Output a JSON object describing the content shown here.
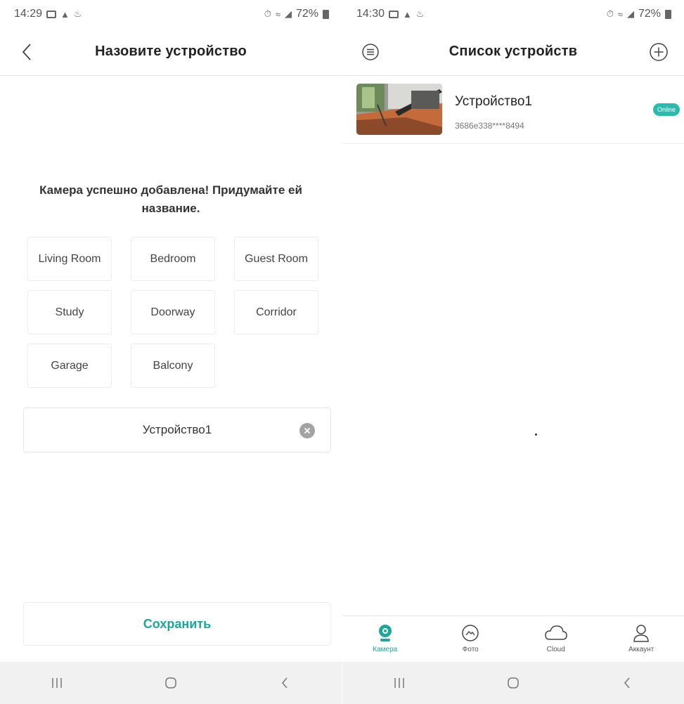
{
  "left": {
    "status": {
      "time": "14:29",
      "battery": "72%"
    },
    "header": {
      "title": "Назовите устройство"
    },
    "prompt": "Камера успешно добавлена! Придумайте ей название.",
    "chips": [
      "Living Room",
      "Bedroom",
      "Guest Room",
      "Study",
      "Doorway",
      "Corridor",
      "Garage",
      "Balcony"
    ],
    "name_input": {
      "value": "Устройство1"
    },
    "save_label": "Сохранить"
  },
  "right": {
    "status": {
      "time": "14:30",
      "battery": "72%"
    },
    "header": {
      "title": "Список устройств"
    },
    "device": {
      "name": "Устройство1",
      "id": "3686e338****8494",
      "status": "Online"
    },
    "tabs": [
      {
        "label": "Камера",
        "icon": "camera-icon",
        "active": true
      },
      {
        "label": "Фото",
        "icon": "photo-icon",
        "active": false
      },
      {
        "label": "Cloud",
        "icon": "cloud-icon",
        "active": false
      },
      {
        "label": "Аккаунт",
        "icon": "account-icon",
        "active": false
      }
    ]
  },
  "colors": {
    "accent": "#1ea69c",
    "badge": "#2bbbad"
  }
}
